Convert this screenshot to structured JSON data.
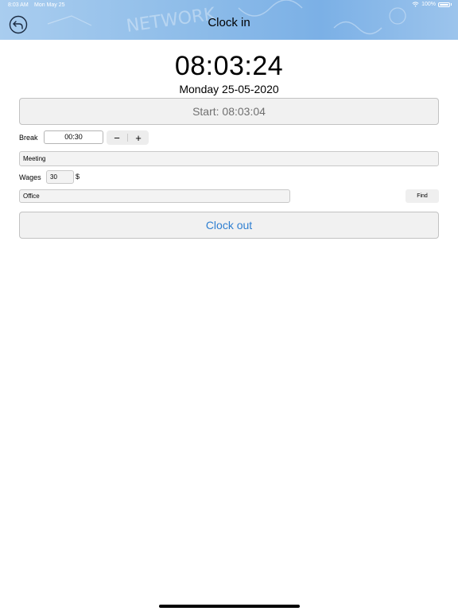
{
  "status_bar": {
    "time": "8:03 AM",
    "date": "Mon May 25",
    "battery": "100%"
  },
  "header": {
    "title": "Clock in",
    "back_icon": "back-arrow-circle-icon",
    "background_color": "#8fbde9"
  },
  "clock": {
    "time": "08:03:24",
    "date": "Monday 25-05-2020"
  },
  "start_button": {
    "label": "Start: 08:03:04"
  },
  "break": {
    "label": "Break",
    "value": "00:30",
    "decrement_label": "−",
    "increment_label": "+"
  },
  "meeting": {
    "value": "Meeting"
  },
  "wages": {
    "label": "Wages",
    "value": "30",
    "currency": "$"
  },
  "office": {
    "value": "Office",
    "find_label": "Find"
  },
  "clock_out": {
    "label": "Clock out",
    "color": "#2f7fd1"
  }
}
